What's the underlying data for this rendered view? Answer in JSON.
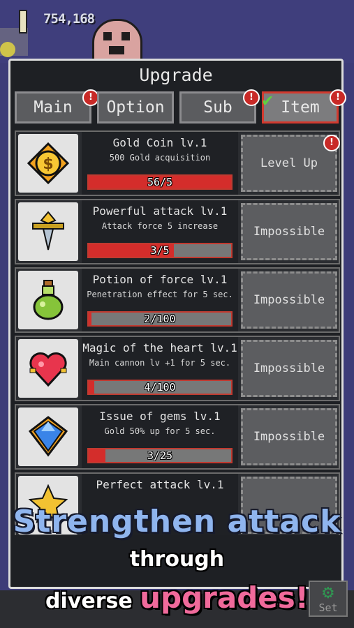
{
  "hud": {
    "score": "754,168"
  },
  "panel": {
    "title": "Upgrade"
  },
  "tabs": [
    {
      "label": "Main",
      "alert": "!"
    },
    {
      "label": "Option",
      "alert": ""
    },
    {
      "label": "Sub",
      "alert": "!"
    },
    {
      "label": "Item",
      "alert": "!",
      "active": true
    }
  ],
  "items": [
    {
      "name": "Gold Coin lv.1",
      "desc": "500 Gold acquisition",
      "progress_text": "56/5",
      "progress": 1.0,
      "button": "Level Up",
      "alert": "!",
      "icon": "gold-coin-icon"
    },
    {
      "name": "Powerful attack lv.1",
      "desc": "Attack force 5 increase",
      "progress_text": "3/5",
      "progress": 0.6,
      "button": "Impossible",
      "icon": "sword-icon"
    },
    {
      "name": "Potion of force lv.1",
      "desc": "Penetration effect for 5 sec.",
      "progress_text": "2/100",
      "progress": 0.02,
      "button": "Impossible",
      "icon": "potion-icon"
    },
    {
      "name": "Magic of the heart lv.1",
      "desc": "Main cannon lv +1 for 5 sec.",
      "progress_text": "4/100",
      "progress": 0.04,
      "button": "Impossible",
      "icon": "heart-icon"
    },
    {
      "name": "Issue of gems lv.1",
      "desc": "Gold 50% up for 5 sec.",
      "progress_text": "3/25",
      "progress": 0.12,
      "button": "Impossible",
      "icon": "gem-icon"
    },
    {
      "name": "Perfect attack lv.1",
      "desc": "",
      "progress_text": "",
      "progress": 0,
      "button": "",
      "icon": "star-icon"
    }
  ],
  "promo": {
    "line1": "Strengthen attack",
    "line2": "through",
    "line3a": "diverse ",
    "line3b": "upgrades!"
  },
  "bottom": {
    "set_label": "Set"
  },
  "colors": {
    "accent_red": "#d42d2b",
    "tab_active_border": "#d23a2f",
    "promo_blue": "#8fb5ee",
    "promo_pink": "#f06a9b"
  }
}
